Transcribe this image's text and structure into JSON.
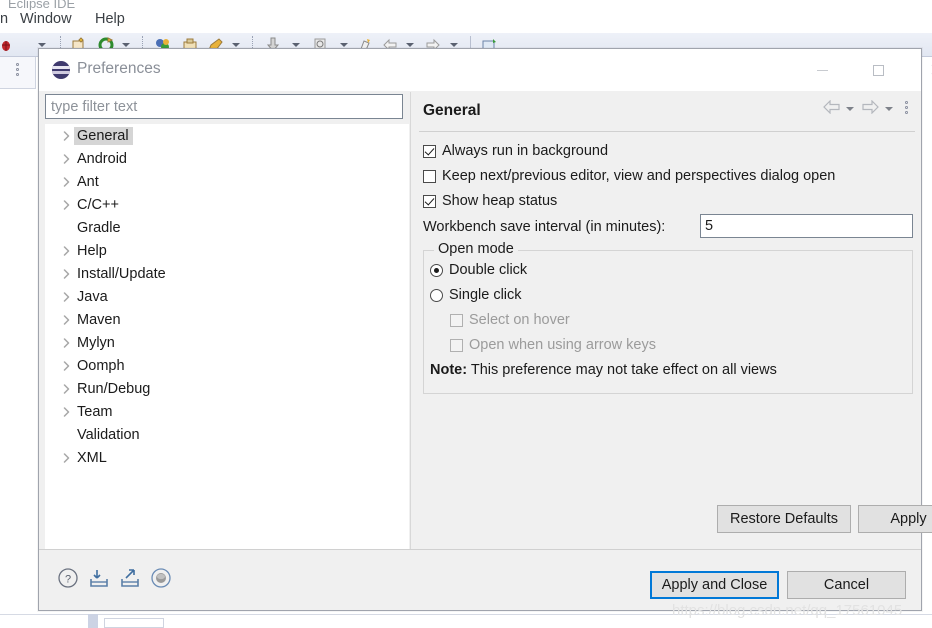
{
  "background": {
    "app_title": "Eclipse IDE",
    "menu_items": [
      "n",
      "Window",
      "Help"
    ],
    "toolbar_icons": [
      "bug-icon",
      "dropdown-caret",
      "new-project-icon",
      "refresh-icon",
      "dropdown-caret",
      "debug-icon",
      "save-icon",
      "edit-icon",
      "dropdown-caret",
      "download-icon",
      "dropdown-caret",
      "search-icon",
      "dropdown-caret",
      "marker-icon",
      "back-arrow-icon",
      "dropdown-caret",
      "forward-arrow-icon",
      "dropdown-caret",
      "new-editor-icon"
    ],
    "left_stub_icon": "view-menu-icon"
  },
  "dialog": {
    "title": "Preferences",
    "logo_icon": "eclipse-logo-icon",
    "window_buttons": {
      "minimize": "minimize-icon",
      "maximize": "maximize-icon",
      "close": "close-icon"
    }
  },
  "filter": {
    "placeholder": "type filter text",
    "value": ""
  },
  "tree": {
    "items": [
      {
        "label": "General",
        "expandable": true,
        "selected": true
      },
      {
        "label": "Android",
        "expandable": true,
        "selected": false
      },
      {
        "label": "Ant",
        "expandable": true,
        "selected": false
      },
      {
        "label": "C/C++",
        "expandable": true,
        "selected": false
      },
      {
        "label": "Gradle",
        "expandable": false,
        "selected": false
      },
      {
        "label": "Help",
        "expandable": true,
        "selected": false
      },
      {
        "label": "Install/Update",
        "expandable": true,
        "selected": false
      },
      {
        "label": "Java",
        "expandable": true,
        "selected": false
      },
      {
        "label": "Maven",
        "expandable": true,
        "selected": false
      },
      {
        "label": "Mylyn",
        "expandable": true,
        "selected": false
      },
      {
        "label": "Oomph",
        "expandable": true,
        "selected": false
      },
      {
        "label": "Run/Debug",
        "expandable": true,
        "selected": false
      },
      {
        "label": "Team",
        "expandable": true,
        "selected": false
      },
      {
        "label": "Validation",
        "expandable": false,
        "selected": false
      },
      {
        "label": "XML",
        "expandable": true,
        "selected": false
      }
    ]
  },
  "panel": {
    "title": "General",
    "nav": {
      "back_icon": "back-arrow-icon",
      "back_caret_icon": "chevron-down-icon",
      "forward_icon": "forward-arrow-icon",
      "forward_caret_icon": "chevron-down-icon",
      "menu_icon": "view-menu-icon"
    },
    "checkboxes": [
      {
        "label": "Always run in background",
        "checked": true,
        "enabled": true
      },
      {
        "label": "Keep next/previous editor, view and perspectives dialog open",
        "checked": false,
        "enabled": true
      },
      {
        "label": "Show heap status",
        "checked": true,
        "enabled": true
      }
    ],
    "save_interval": {
      "label": "Workbench save interval (in minutes):",
      "value": "5"
    },
    "open_mode": {
      "legend": "Open mode",
      "radios": [
        {
          "label": "Double click",
          "selected": true
        },
        {
          "label": "Single click",
          "selected": false
        }
      ],
      "sub_checkboxes": [
        {
          "label": "Select on hover",
          "checked": false,
          "enabled": false
        },
        {
          "label": "Open when using arrow keys",
          "checked": false,
          "enabled": false
        }
      ],
      "note_prefix": "Note:",
      "note_text": "This preference may not take effect on all views"
    },
    "buttons": {
      "restore_defaults": "Restore Defaults",
      "apply": "Apply"
    }
  },
  "footer": {
    "icons": [
      {
        "name": "help-icon"
      },
      {
        "name": "import-icon"
      },
      {
        "name": "export-icon"
      },
      {
        "name": "oomph-recorder-icon"
      }
    ],
    "apply_and_close": "Apply and Close",
    "cancel": "Cancel"
  },
  "watermark": "https://blog.csdn.net/qq_17561045",
  "colors": {
    "focus_blue": "#0078d7",
    "dialog_bg": "#f0f0f0",
    "selection_gray": "#d5d5d5"
  }
}
